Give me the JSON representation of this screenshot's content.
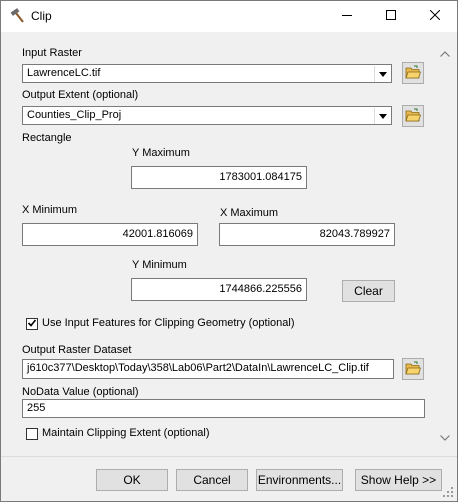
{
  "window": {
    "title": "Clip",
    "icon": "hammer-icon"
  },
  "form": {
    "input_raster": {
      "label": "Input Raster",
      "value": "LawrenceLC.tif"
    },
    "output_extent": {
      "label": "Output Extent (optional)",
      "value": "Counties_Clip_Proj"
    },
    "rectangle": {
      "label": "Rectangle",
      "y_max_label": "Y Maximum",
      "y_max": "1783001.084175",
      "x_min_label": "X Minimum",
      "x_min": "42001.816069",
      "x_max_label": "X Maximum",
      "x_max": "82043.789927",
      "y_min_label": "Y Minimum",
      "y_min": "1744866.225556",
      "clear_label": "Clear"
    },
    "use_input_features": {
      "label": "Use Input Features for Clipping Geometry (optional)",
      "checked": true
    },
    "output_raster": {
      "label": "Output Raster Dataset",
      "value": "j610c377\\Desktop\\Today\\358\\Lab06\\Part2\\DataIn\\LawrenceLC_Clip.tif"
    },
    "nodata": {
      "label": "NoData Value (optional)",
      "value": "255"
    },
    "maintain_extent": {
      "label": "Maintain Clipping Extent (optional)",
      "checked": false
    }
  },
  "buttons": {
    "ok": "OK",
    "cancel": "Cancel",
    "environments": "Environments...",
    "show_help": "Show Help >>"
  }
}
